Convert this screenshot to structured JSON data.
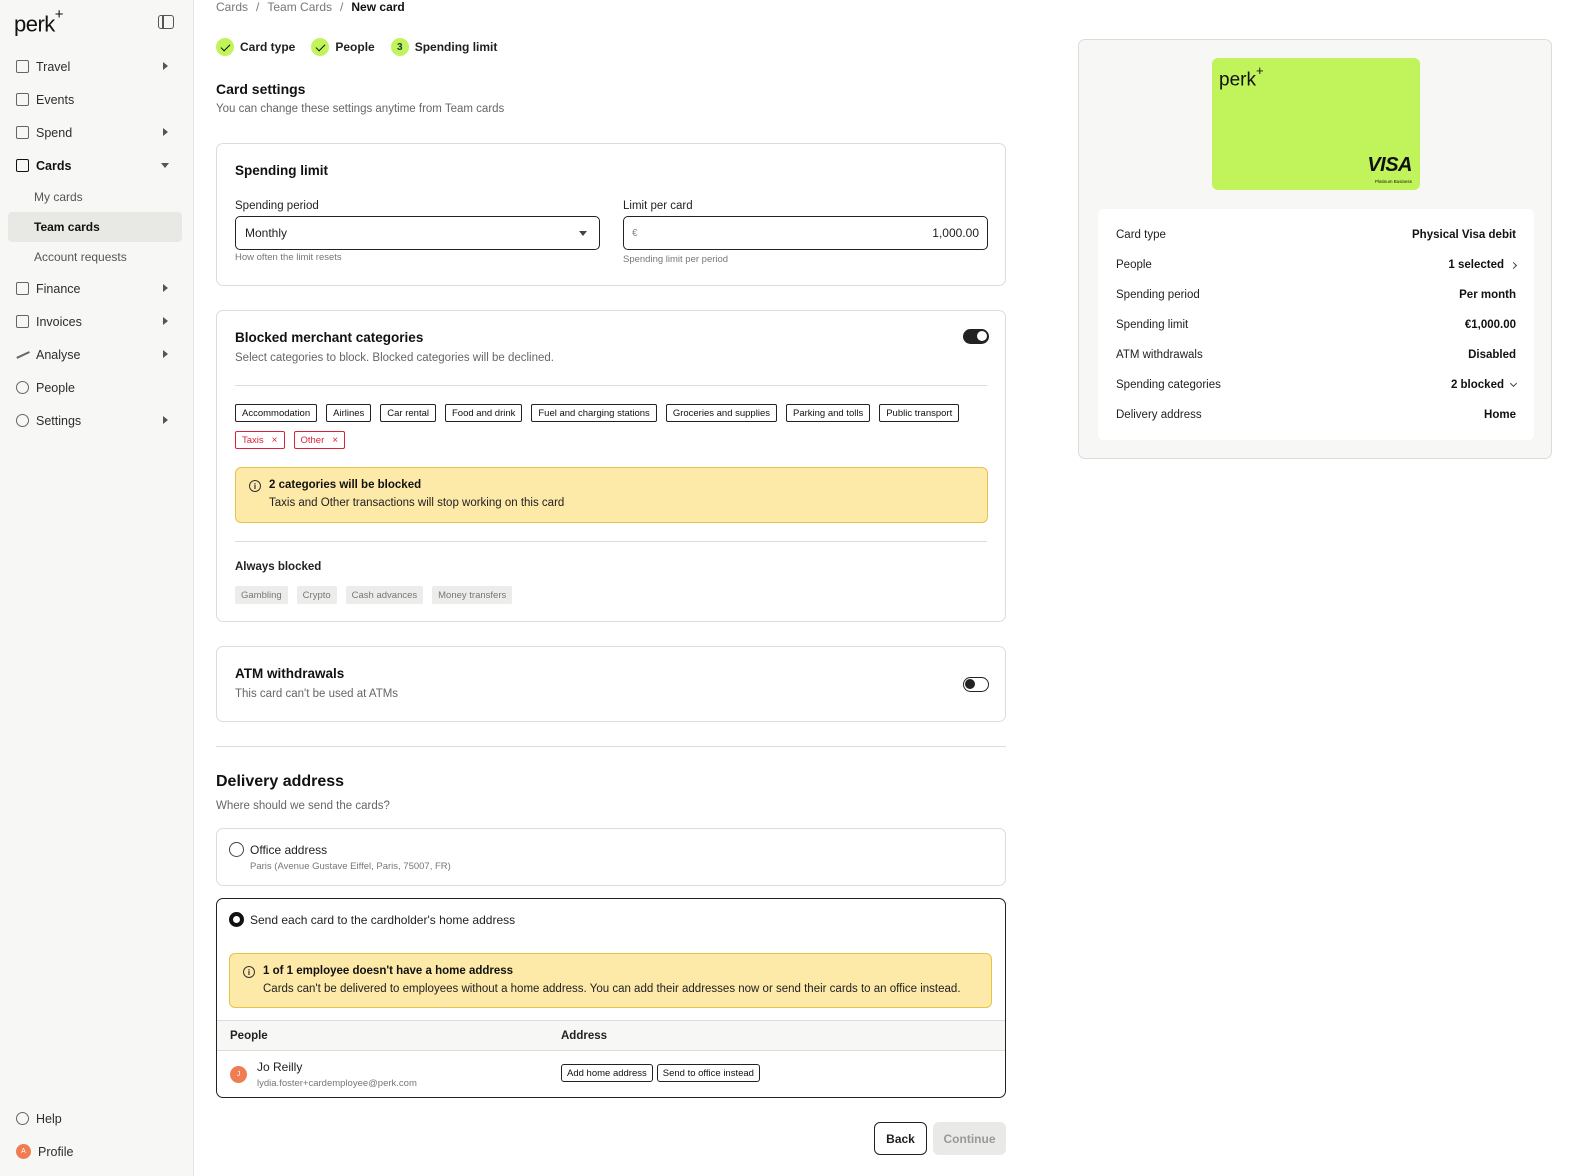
{
  "sidebar": {
    "brand": "perk",
    "brand_mark": "+",
    "items": [
      {
        "label": "Travel"
      },
      {
        "label": "Events"
      },
      {
        "label": "Spend"
      },
      {
        "label": "Cards",
        "sub": [
          {
            "label": "My cards"
          },
          {
            "label": "Team cards"
          },
          {
            "label": "Account requests"
          }
        ]
      },
      {
        "label": "Finance"
      },
      {
        "label": "Invoices"
      },
      {
        "label": "Analyse"
      },
      {
        "label": "People"
      },
      {
        "label": "Settings"
      }
    ],
    "help": "Help",
    "profile": "Profile",
    "profile_initial": "A"
  },
  "breadcrumb": [
    "Cards",
    "Team Cards",
    "New card"
  ],
  "stepper": [
    {
      "label": "Card type",
      "state": "done"
    },
    {
      "label": "People",
      "state": "done"
    },
    {
      "label": "Spending limit",
      "state": "current",
      "number": "3"
    }
  ],
  "settings": {
    "title": "Card settings",
    "subtitle": "You can change these settings anytime from Team cards"
  },
  "spending_limit": {
    "title": "Spending limit",
    "period_label": "Spending period",
    "period_value": "Monthly",
    "period_hint": "How often the limit resets",
    "limit_label": "Limit per card",
    "currency": "€",
    "limit_value": "1,000.00",
    "limit_hint": "Spending limit per period"
  },
  "blocked": {
    "title": "Blocked merchant categories",
    "subtitle": "Select categories to block. Blocked categories will be declined.",
    "enabled": true,
    "categories": [
      {
        "label": "Accommodation",
        "blocked": false
      },
      {
        "label": "Airlines",
        "blocked": false
      },
      {
        "label": "Car rental",
        "blocked": false
      },
      {
        "label": "Food and drink",
        "blocked": false
      },
      {
        "label": "Fuel and charging stations",
        "blocked": false
      },
      {
        "label": "Groceries and supplies",
        "blocked": false
      },
      {
        "label": "Parking and tolls",
        "blocked": false
      },
      {
        "label": "Public transport",
        "blocked": false
      },
      {
        "label": "Taxis",
        "blocked": true
      },
      {
        "label": "Other",
        "blocked": true
      }
    ],
    "remove_glyph": "×",
    "warning_title": "2 categories will be blocked",
    "warning_text": "Taxis and Other transactions will stop working on this card",
    "always_title": "Always blocked",
    "always": [
      "Gambling",
      "Crypto",
      "Cash advances",
      "Money transfers"
    ]
  },
  "atm": {
    "title": "ATM withdrawals",
    "subtitle": "This card can't be used at ATMs",
    "enabled": false
  },
  "delivery": {
    "title": "Delivery address",
    "subtitle": "Where should we send the cards?",
    "office_label": "Office address",
    "office_detail": "Paris (Avenue Gustave Eiffel, Paris, 75007, FR)",
    "home_label": "Send each card to the cardholder's home address",
    "warning_title": "1 of 1 employee doesn't have a home address",
    "warning_text": "Cards can't be delivered to employees without a home address. You can add their addresses now or send their cards to an office instead.",
    "col_people": "People",
    "col_address": "Address",
    "person_name": "Jo Reilly",
    "person_email": "lydia.foster+cardemployee@perk.com",
    "person_initial": "J",
    "add_home": "Add home address",
    "send_office": "Send to office instead"
  },
  "actions": {
    "back": "Back",
    "continue": "Continue"
  },
  "preview": {
    "card_brand": "perk",
    "card_mark": "+",
    "network": "VISA",
    "network_sub": "Platinum Business",
    "rows": [
      {
        "k": "Card type",
        "v": "Physical Visa debit"
      },
      {
        "k": "People",
        "v": "1 selected"
      },
      {
        "k": "Spending period",
        "v": "Per month"
      },
      {
        "k": "Spending limit",
        "v": "€1,000.00"
      },
      {
        "k": "ATM withdrawals",
        "v": "Disabled"
      },
      {
        "k": "Spending categories",
        "v": "2 blocked"
      },
      {
        "k": "Delivery address",
        "v": "Home"
      }
    ]
  },
  "colors": {
    "accent": "#c1f35a",
    "warning_bg": "#fde9a8",
    "blocked": "#d9233c"
  }
}
